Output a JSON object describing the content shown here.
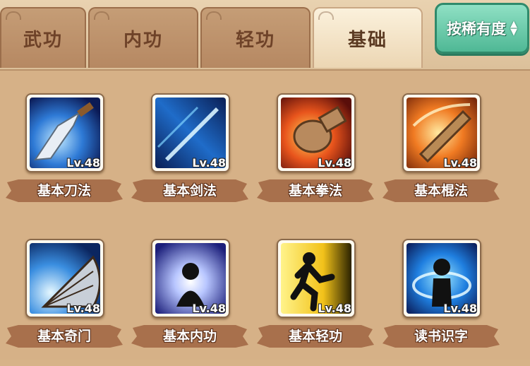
{
  "tabs": [
    {
      "label": "武功",
      "active": false
    },
    {
      "label": "内功",
      "active": false
    },
    {
      "label": "轻功",
      "active": false
    },
    {
      "label": "基础",
      "active": true
    }
  ],
  "sort_button": {
    "label": "按稀有度",
    "icon": "up-down-arrows-icon"
  },
  "skills": [
    {
      "name": "基本刀法",
      "level": "Lv.48",
      "icon": "blade-icon"
    },
    {
      "name": "基本剑法",
      "level": "Lv.48",
      "icon": "sword-icon"
    },
    {
      "name": "基本拳法",
      "level": "Lv.48",
      "icon": "fist-icon"
    },
    {
      "name": "基本棍法",
      "level": "Lv.48",
      "icon": "staff-icon"
    },
    {
      "name": "基本奇门",
      "level": "Lv.48",
      "icon": "fan-icon"
    },
    {
      "name": "基本内功",
      "level": "Lv.48",
      "icon": "meditation-icon"
    },
    {
      "name": "基本轻功",
      "level": "Lv.48",
      "icon": "running-icon"
    },
    {
      "name": "读书识字",
      "level": "Lv.48",
      "icon": "reading-icon"
    }
  ],
  "colors": {
    "tab": "#b68862",
    "tab_active": "#f5e6c8",
    "sort_button": "#4fb895",
    "panel": "#d6b187",
    "label_band": "#a8704c"
  }
}
